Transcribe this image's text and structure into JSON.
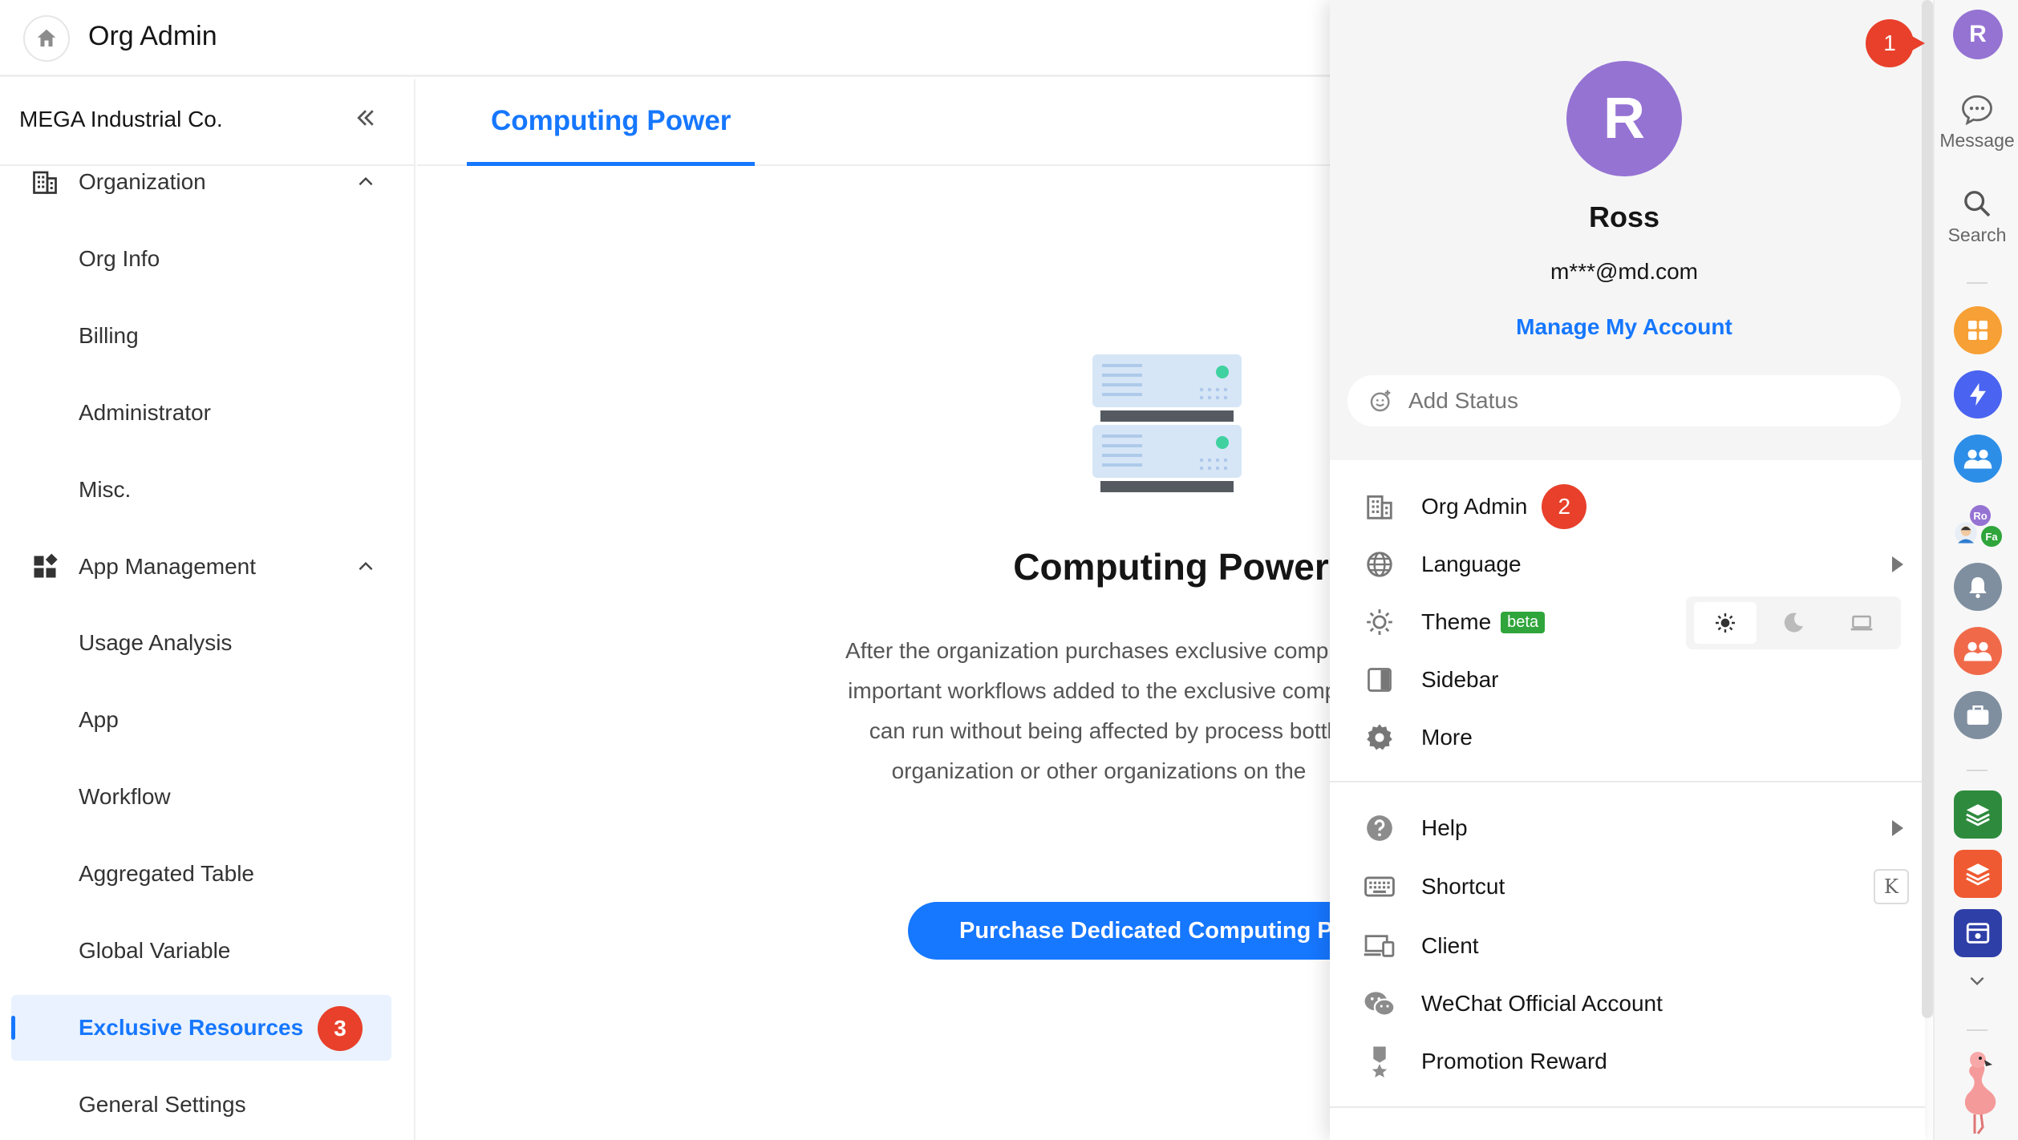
{
  "header": {
    "title": "Org Admin"
  },
  "sidebar": {
    "org_name": "MEGA Industrial Co.",
    "groups": [
      {
        "label": "Organization",
        "items": [
          "Org Info",
          "Billing",
          "Administrator",
          "Misc."
        ]
      },
      {
        "label": "App Management",
        "items": [
          "Usage Analysis",
          "App",
          "Workflow",
          "Aggregated Table",
          "Global Variable",
          "Exclusive Resources",
          "General Settings"
        ]
      }
    ],
    "active_item": "Exclusive Resources"
  },
  "main": {
    "tab": "Computing Power",
    "hero_title": "Computing Power",
    "description": [
      "After the organization purchases exclusive computi",
      "important workflows added to the exclusive compu",
      "can run without being affected by process bottle",
      "organization or other organizations on the"
    ],
    "purchase_button": "Purchase Dedicated Computing Po"
  },
  "account_menu": {
    "avatar_letter": "R",
    "name": "Ross",
    "email": "m***@md.com",
    "manage_link": "Manage My Account",
    "status_placeholder": "Add Status",
    "items_primary": [
      "Org Admin",
      "Language",
      "Theme",
      "Sidebar",
      "More"
    ],
    "theme_badge": "beta",
    "theme_modes": [
      "light",
      "dark",
      "system"
    ],
    "theme_selected": "light",
    "items_secondary": [
      "Help",
      "Shortcut",
      "Client",
      "WeChat Official Account",
      "Promotion Reward"
    ],
    "shortcut_key": "K"
  },
  "markers": [
    "1",
    "2",
    "3"
  ],
  "rail": {
    "avatar_letter": "R",
    "message_label": "Message",
    "search_label": "Search",
    "mini_avatars": [
      "Ro",
      "Fa"
    ],
    "apps": [
      "grid-app",
      "bolt-app",
      "contacts-app",
      "team-avatars",
      "bell-app",
      "group-app",
      "briefcase-app",
      "green-app",
      "orange-app",
      "navy-app"
    ]
  },
  "colors": {
    "accent": "#1677ff",
    "avatar": "#9573d3",
    "marker": "#e8402b",
    "beta": "#2fa53c"
  }
}
